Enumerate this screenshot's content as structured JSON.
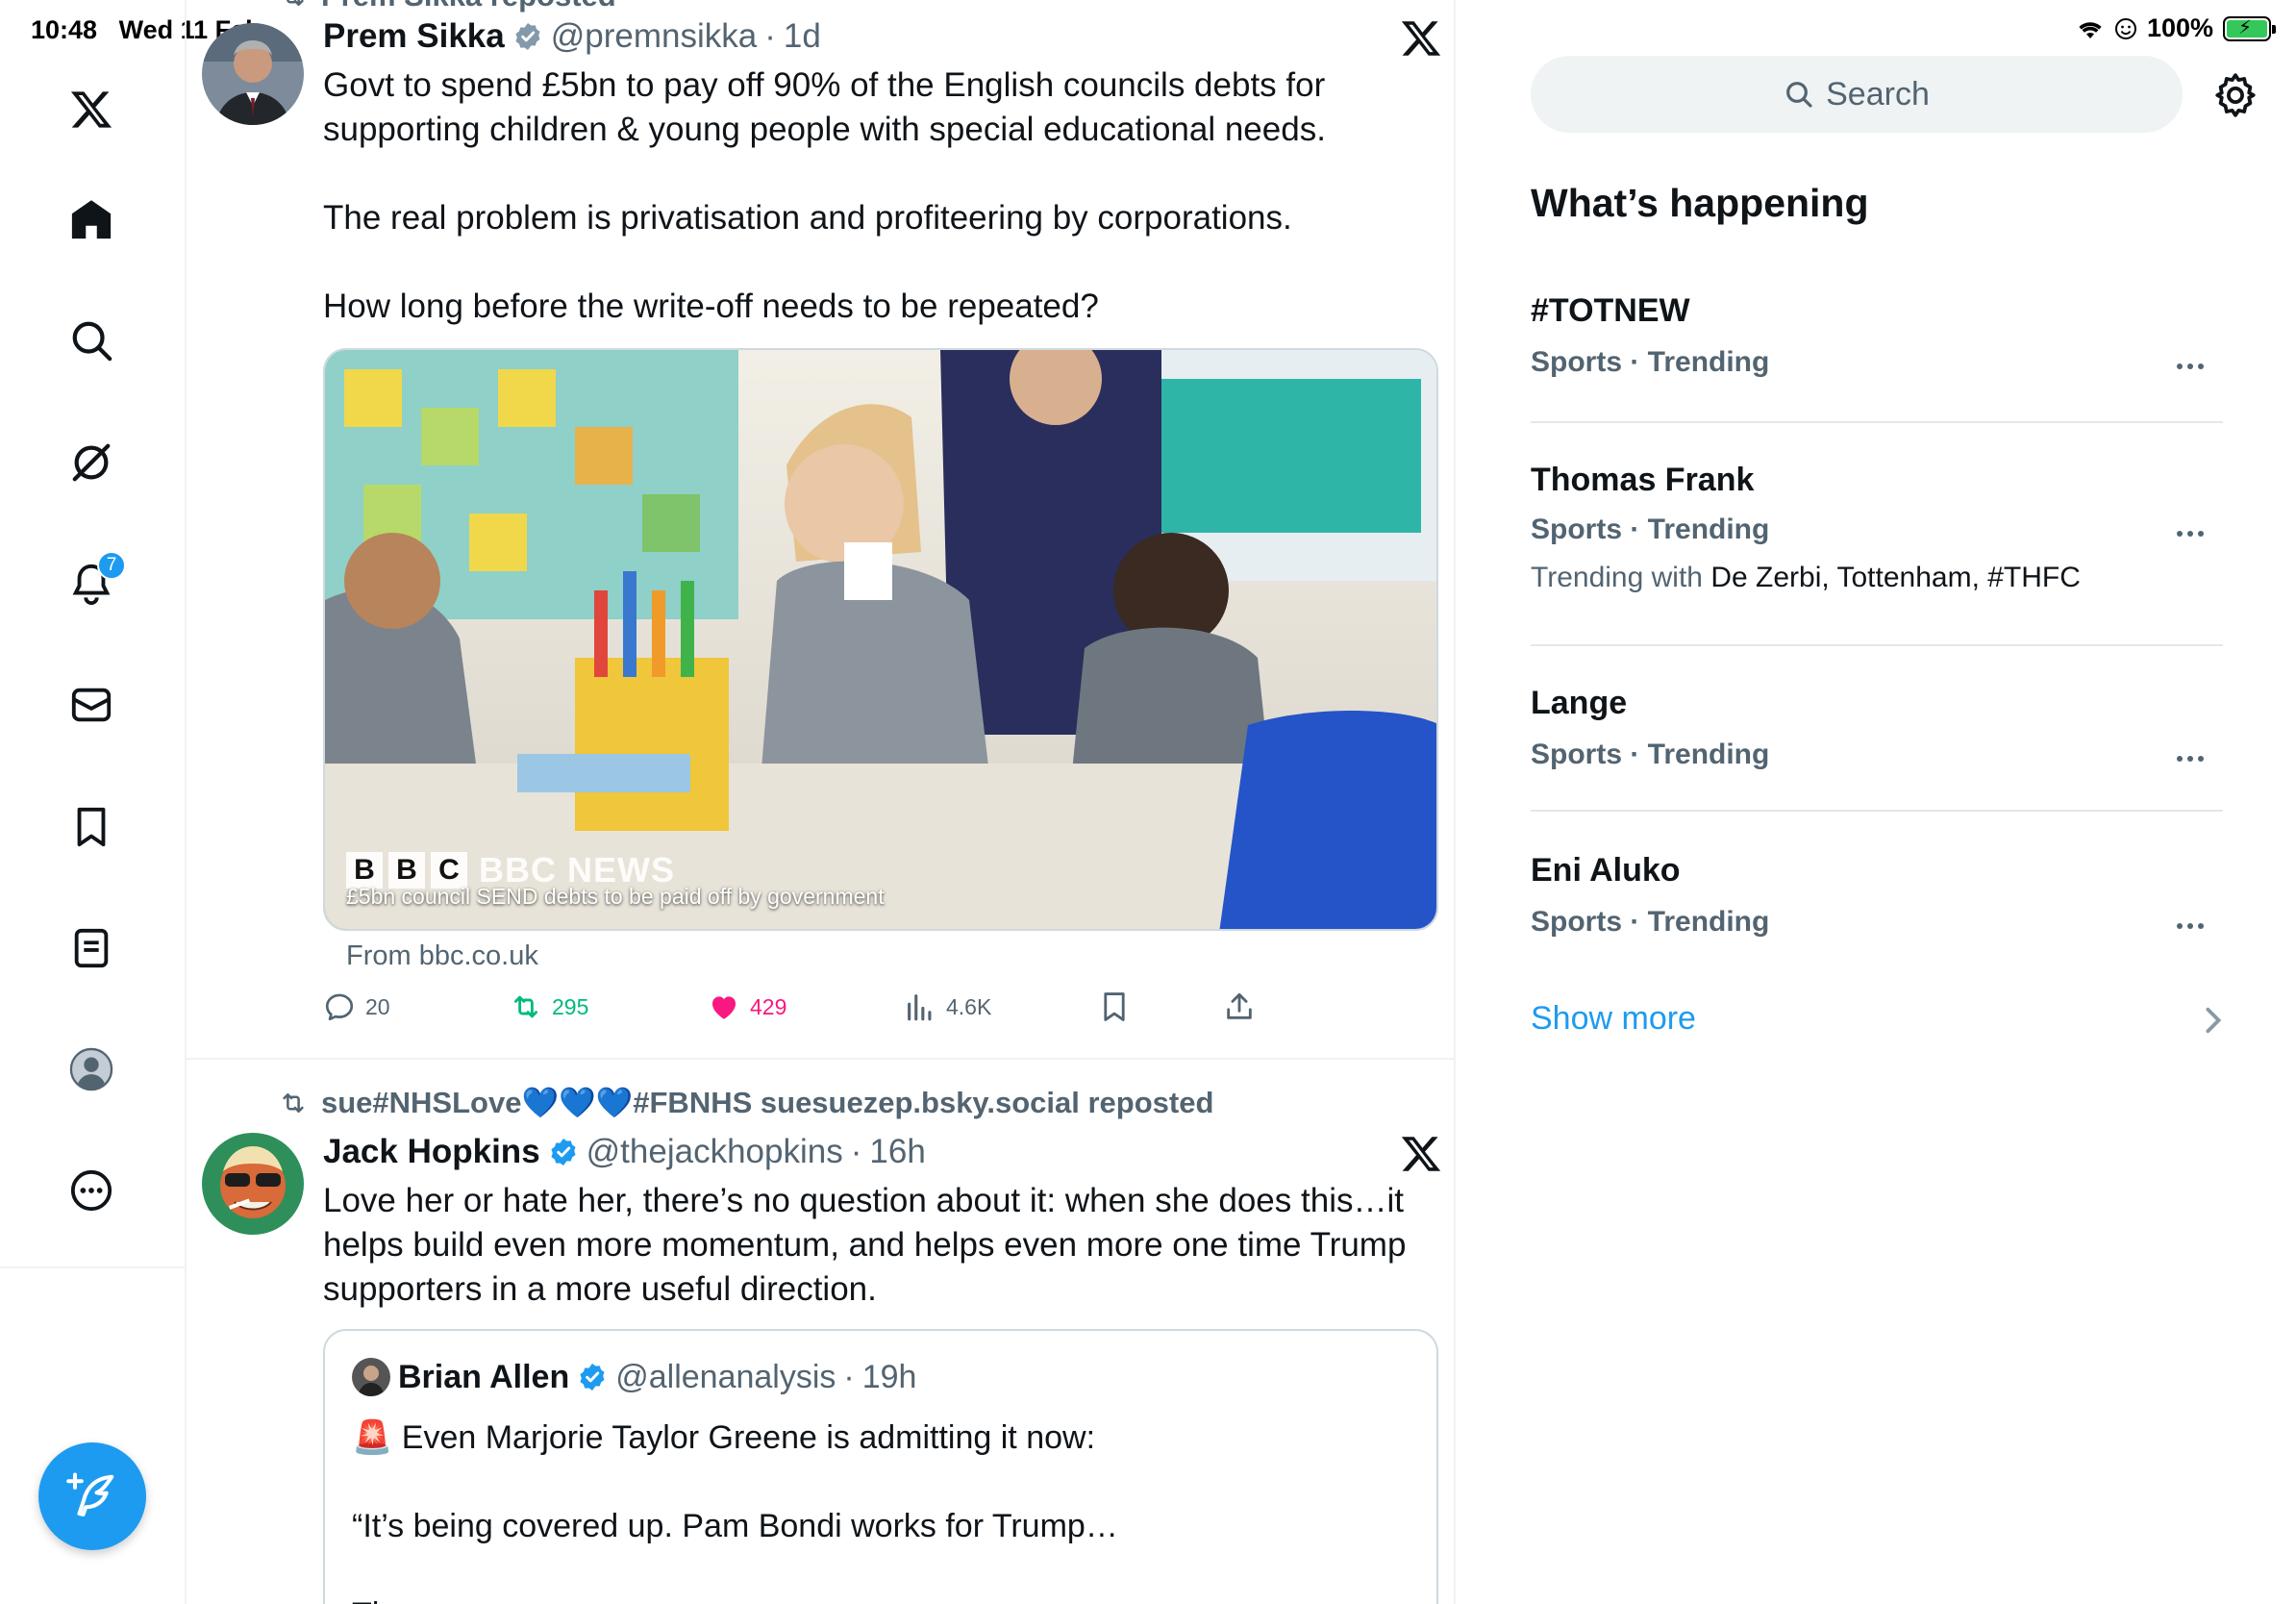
{
  "status_bar": {
    "time": "10:48",
    "date": "Wed 11 Feb",
    "battery": "100%"
  },
  "nav": {
    "items": [
      "x-logo",
      "home",
      "search",
      "grok",
      "notifications",
      "messages",
      "bookmarks",
      "lists",
      "profile",
      "more"
    ],
    "notification_count": "7"
  },
  "tweets": [
    {
      "repost_context": "Prem Sikka reposted",
      "name": "Prem Sikka",
      "handle": "@premnsikka",
      "time": "1d",
      "text": "Govt to spend £5bn to pay off 90% of the English councils debts for supporting children & young people with special educational needs.\n\nThe real problem is privatisation and profiteering by corporations.\n\nHow long before the write-off needs to be repeated?",
      "media": {
        "caption": "£5bn council SEND debts to be paid off by government",
        "source": "From bbc.co.uk",
        "logo": "BBC NEWS"
      },
      "stats": {
        "replies": "20",
        "reposts": "295",
        "likes": "429",
        "views": "4.6K"
      }
    },
    {
      "repost_context": "sue#NHSLove💙💙💙#FBNHS suesuezep.bsky.social reposted",
      "name": "Jack Hopkins",
      "handle": "@thejackhopkins",
      "time": "16h",
      "text": "Love her or hate her, there’s no question about it: when she does this…it helps build even more momentum, and helps even more one time Trump supporters in a more useful direction.",
      "quote": {
        "name": "Brian Allen",
        "handle": "@allenanalysis",
        "time": "19h",
        "text": "🚨 Even Marjorie Taylor Greene is admitting it now:\n\n“It’s being covered up. Pam Bondi works for Trump…\n\nThe p…"
      }
    }
  ],
  "sidebar": {
    "search_placeholder": "Search",
    "section_title": "What’s happening",
    "trends": [
      {
        "name": "#TOTNEW",
        "meta": "Sports · Trending"
      },
      {
        "name": "Thomas Frank",
        "meta": "Sports · Trending",
        "with_label": "Trending with",
        "with_names": "De Zerbi, Tottenham, #THFC"
      },
      {
        "name": "Lange",
        "meta": "Sports · Trending"
      },
      {
        "name": "Eni Aluko",
        "meta": "Sports · Trending"
      }
    ],
    "show_more": "Show more"
  },
  "colors": {
    "accent": "#1d9bf0",
    "repost": "#00ba7c",
    "like": "#f91880",
    "secondary_text": "#536471"
  }
}
